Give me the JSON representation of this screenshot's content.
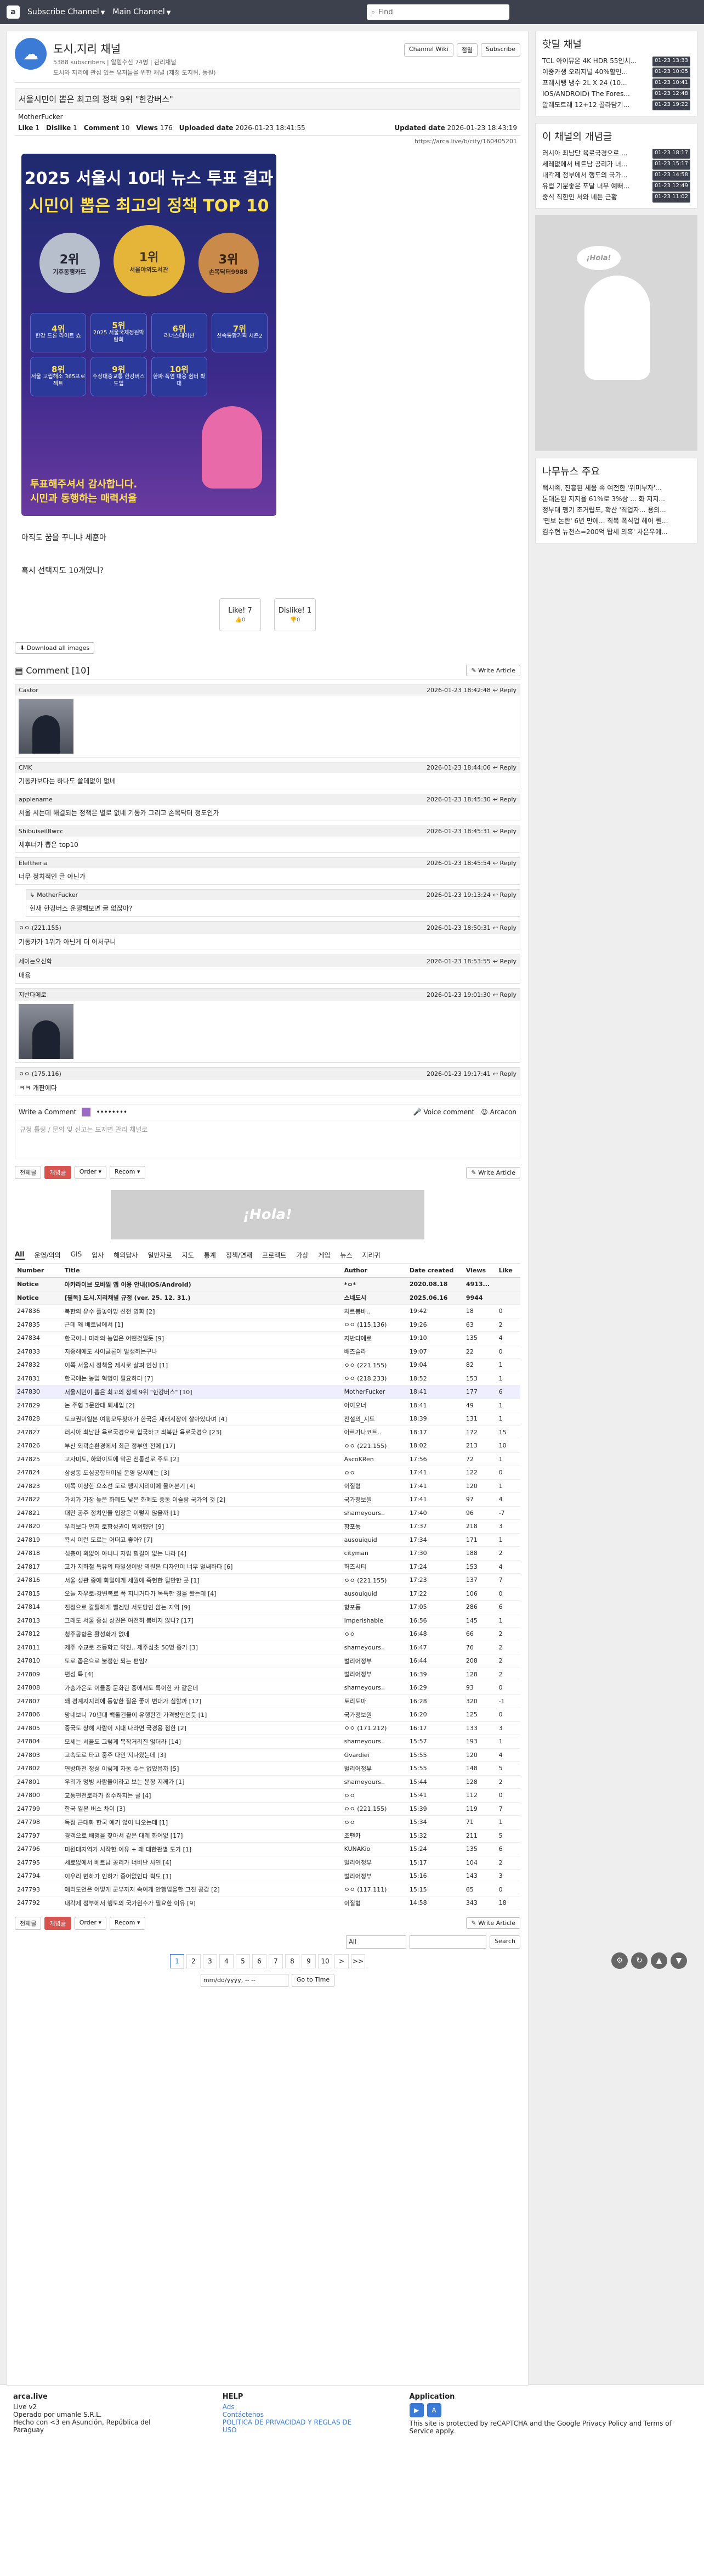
{
  "nav": {
    "channel1": "Subscribe Channel",
    "channel2": "Main Channel",
    "search_placeholder": "Find"
  },
  "channel": {
    "name": "도시.지리 채널",
    "subs": "5388 subscribers | 알림수신 74명 | 관리채널",
    "desc": "도시와 지리에 관심 있는 유저들을 위한 채널 (제정 도지위, 동원)",
    "btn_wiki": "Channel Wiki",
    "btn_block": "점멸",
    "btn_sub": "Subscribe"
  },
  "article": {
    "title": "서울시민이 뽑은 최고의 정책 9위 \"한강버스\"",
    "author": "MotherFucker",
    "like_label": "Like",
    "like": "1",
    "dislike_label": "Dislike",
    "dislike": "1",
    "comment_label": "Comment",
    "comments": "10",
    "views_label": "Views",
    "views": "176",
    "uploaded_label": "Uploaded date",
    "uploaded": "2026-01-23 18:41:55",
    "updated_label": "Updated date",
    "updated": "2026-01-23 18:43:19",
    "url": "https://arca.live/b/city/160405201",
    "lines": [
      "아직도 꿈을 꾸니냐 세훈아",
      "혹시 선택지도 10개였니?"
    ],
    "download": "Download all images",
    "vote_like": "Like! 7",
    "vote_dislike": "Dislike! 1",
    "vote_like_sub": "0",
    "vote_dislike_sub": "0"
  },
  "poster": {
    "title1": "2025 서울시 10대 뉴스 투표 결과",
    "title2": "시민이 뽑은 최고의 정책 TOP 10",
    "medals": [
      {
        "rank": "2위",
        "text": "기후동행카드"
      },
      {
        "rank": "1위",
        "text": "서울야외도서관"
      },
      {
        "rank": "3위",
        "text": "손목닥터9988"
      }
    ],
    "cells": [
      {
        "rank": "4위",
        "text": "한강 드론 라이트 쇼"
      },
      {
        "rank": "5위",
        "text": "2025 서울국제정원박람회"
      },
      {
        "rank": "6위",
        "text": "러너스테이션"
      },
      {
        "rank": "7위",
        "text": "신속통합기획 시즌2"
      },
      {
        "rank": "8위",
        "text": "서울 고립해소 365프로젝트"
      },
      {
        "rank": "9위",
        "text": "수상대중교통 한강버스 도입"
      },
      {
        "rank": "10위",
        "text": "한파·폭염 대응 쉼터 확대"
      },
      {
        "rank": "",
        "text": ""
      }
    ],
    "foot1": "투표해주셔서 감사합니다.",
    "foot2": "시민과 동행하는 매력서울"
  },
  "comments": {
    "title": "Comment",
    "count": "[10]",
    "write": "Write Article",
    "reply": "Reply",
    "items": [
      {
        "user": "Castor",
        "date": "2026-01-23 18:42:48",
        "text": "",
        "photo": true,
        "reply": false
      },
      {
        "user": "CMK",
        "date": "2026-01-23 18:44:06",
        "text": "기동카보다는 하나도 쓸데없이 없네",
        "photo": false,
        "reply": false
      },
      {
        "user": "applename",
        "date": "2026-01-23 18:45:30",
        "text": "서울 시는데 해결되는 정책은 별로 없네 기동카 그리고 손목닥터 정도인가",
        "photo": false,
        "reply": false
      },
      {
        "user": "ShibuiseilBwcc",
        "date": "2026-01-23 18:45:31",
        "text": "세후너가 뽑은 top10",
        "photo": false,
        "reply": false
      },
      {
        "user": "Eleftheria",
        "date": "2026-01-23 18:45:54",
        "text": "너무 정치적인 글 아닌가",
        "photo": false,
        "reply": false
      },
      {
        "user": "MotherFucker",
        "date": "2026-01-23 19:13:24",
        "text": "현재 한강버스 운행해보면 글 없잖아?",
        "photo": false,
        "reply": true
      },
      {
        "user": "ㅇㅇ (221.155)",
        "date": "2026-01-23 18:50:31",
        "text": "기동카가 1위가 아닌게 더 어처구니",
        "photo": false,
        "reply": false,
        "anon": true
      },
      {
        "user": "세이는오신학",
        "date": "2026-01-23 18:53:55",
        "text": "매용",
        "photo": false,
        "reply": false
      },
      {
        "user": "지반다에로",
        "date": "2026-01-23 19:01:30",
        "text": "",
        "photo": true,
        "reply": false
      },
      {
        "user": "ㅇㅇ (175.116)",
        "date": "2026-01-23 19:17:41",
        "text": "ㅋㅋ 개판에다",
        "photo": false,
        "reply": false,
        "anon": true
      }
    ],
    "write_label": "Write a Comment",
    "voice": "Voice comment",
    "arcacon": "Arcacon",
    "placeholder": "규정 틀링 / 문의 및 신고는 도지면 관리 채널로"
  },
  "list": {
    "btn_all": "전체글",
    "btn_best": "개념글",
    "order": "Order",
    "recom": "Recom",
    "write": "Write Article",
    "cats": [
      "All",
      "운영/의의",
      "GIS",
      "입사",
      "해외답사",
      "일반자료",
      "지도",
      "통계",
      "정책/연재",
      "프로젝트",
      "가상",
      "게임",
      "뉴스",
      "지리퀴"
    ],
    "headers": [
      "Number",
      "Title",
      "Author",
      "Date created",
      "Views",
      "Like"
    ],
    "rows": [
      [
        "Notice",
        "아카라이브 모바일 앱 이용 안내(iOS/Android)",
        "*ㅇ*",
        "2020.08.18",
        "4913...",
        ""
      ],
      [
        "Notice",
        "[필독] 도시.지리채널 규정 (ver. 25. 12. 31.)",
        "스네도시",
        "2025.06.16",
        "9944",
        ""
      ],
      [
        "247836",
        "북한의 유수 풀놓아망 선전 영화 [2]",
        "처르봉바..",
        "19:42",
        "18",
        "0"
      ],
      [
        "247835",
        "근데 왜 베트남에서 [1]",
        "ㅇㅇ (115.136)",
        "19:26",
        "63",
        "2"
      ],
      [
        "247834",
        "한국이나 미래의 농업은 어떤것일듯 [9]",
        "지반다에로",
        "19:10",
        "135",
        "4"
      ],
      [
        "247833",
        "지중해에도 사이클론이 발생하는구나",
        "배즈슬라",
        "19:07",
        "22",
        "0"
      ],
      [
        "247832",
        "이쪽 서울시 정책을 제시로 살펴 인싱 [1]",
        "ㅇㅇ (221.155)",
        "19:04",
        "82",
        "1"
      ],
      [
        "247831",
        "한국에는 농업 혁명이 필요하다 [7]",
        "ㅇㅇ (218.233)",
        "18:52",
        "153",
        "1"
      ],
      [
        "247830",
        "서울시민이 뽑은 최고의 정책 9위 \"한강버스\" [10]",
        "MotherFucker",
        "18:41",
        "177",
        "6"
      ],
      [
        "247829",
        "논 주협 3문안대 퇴세입 [2]",
        "아이오너",
        "18:41",
        "49",
        "1"
      ],
      [
        "247828",
        "도쿄권이일본 여행모두찾아가 한국은 재래시장이 살아있다며 [4]",
        "전설의_지도",
        "18:39",
        "131",
        "1"
      ],
      [
        "247827",
        "러시아 최남단 육로국경으로 입국하고 최북단 육로국경으 [23]",
        "아르가나코트..",
        "18:17",
        "172",
        "15"
      ],
      [
        "247826",
        "부산 외곽순환경에서 최근 정부안 전에 [17]",
        "ㅇㅇ (221.155)",
        "18:02",
        "213",
        "10"
      ],
      [
        "247825",
        "고자미도, 하와이도에 막곤 전통선로 주도 [2]",
        "AscoKRen",
        "17:56",
        "72",
        "1"
      ],
      [
        "247824",
        "삼성동 도심공항터미널 운영 당시에는 [3]",
        "ㅇㅇ",
        "17:41",
        "122",
        "0"
      ],
      [
        "247823",
        "이쪽 이상한 요소선 도로 펭지지리미에 몰어본기 [4]",
        "이질형",
        "17:41",
        "120",
        "1"
      ],
      [
        "247822",
        "가치가 가장 높은 화폐도 낮은 화폐도 중동 이슬람 국가의 것 [2]",
        "국가정보원",
        "17:41",
        "97",
        "4"
      ],
      [
        "247821",
        "대만 공주 정치인들 입장은 이렇지 않을까 [1]",
        "shameyours..",
        "17:40",
        "96",
        "-7"
      ],
      [
        "247820",
        "우리보다 먼저 로함성권이 외쳐했던 [9]",
        "항포동",
        "17:37",
        "218",
        "3"
      ],
      [
        "247819",
        "욕시 이런 도로는 어떠고 좋아? [7]",
        "ausouiquid",
        "17:34",
        "171",
        "1"
      ],
      [
        "247818",
        "심층이 획없이 아니니 자립 힘길이 없는 나라 [4]",
        "cityman",
        "17:30",
        "188",
        "2"
      ],
      [
        "247817",
        "고가 지하철 특유의 타일생이방 역원본 디자인이 너무 멀쌔하다 [6]",
        "허즈시티",
        "17:24",
        "153",
        "4"
      ],
      [
        "247816",
        "서울 성관 중에 화일에게 세월에 족헌한 될만한 곳 [1]",
        "ㅇㅇ (221.155)",
        "17:23",
        "137",
        "7"
      ],
      [
        "247815",
        "오늘 자우로-강변복로 폭 지니거다가 독특한 경을 봤는데 [4]",
        "ausouiquid",
        "17:22",
        "106",
        "0"
      ],
      [
        "247814",
        "진정으로 갈필하게 뻘겐딩 서도당인 않는 지역 [9]",
        "항포동",
        "17:05",
        "286",
        "6"
      ],
      [
        "247813",
        "그래도 서울 중심 상권은 여전히 붐비지 않나? [17]",
        "Imperishable",
        "16:56",
        "145",
        "1"
      ],
      [
        "247812",
        "청주공항은 활성화가 없네",
        "ㅇㅇ",
        "16:48",
        "66",
        "2"
      ],
      [
        "247811",
        "제주 수교로 초등학교 약진.. 제주심초 50명 증가 [3]",
        "shameyours..",
        "16:47",
        "76",
        "2"
      ],
      [
        "247810",
        "도로 좁은으로 불정한 되는 편임?",
        "벌리어정부",
        "16:44",
        "208",
        "2"
      ],
      [
        "247809",
        "편성 특 [4]",
        "벌리어정부",
        "16:39",
        "128",
        "2"
      ],
      [
        "247808",
        "가승가은도 이들중 문화관 중에서도 특이한 카 같은데",
        "shameyours..",
        "16:29",
        "93",
        "0"
      ],
      [
        "247807",
        "왜 경계지지리에 동향한 질운 좋이 변대가 심할까 [17]",
        "토리도마",
        "16:28",
        "320",
        "-1"
      ],
      [
        "247806",
        "망네보니 70년대 백돌건물이 유행한간 가격방안인듯 [1]",
        "국가정보원",
        "16:20",
        "125",
        "0"
      ],
      [
        "247805",
        "중국도 상해 사람이 지대 나라면 국경용 점한 [2]",
        "ㅇㅇ (171.212)",
        "16:17",
        "133",
        "3"
      ],
      [
        "247804",
        "모세는 서울도 그렇게 복작거리진 않더라 [14]",
        "shameyours..",
        "15:57",
        "193",
        "1"
      ],
      [
        "247803",
        "고속도로 타고 중주 다인 지나왔는데 [3]",
        "Gvardiei",
        "15:55",
        "120",
        "4"
      ],
      [
        "247802",
        "연방마전 정성 이렇게 자동 수는 없었음까 [5]",
        "벌리어정부",
        "15:55",
        "148",
        "5"
      ],
      [
        "247801",
        "우리가 멍빙 사람들이라고 보는 분장 지께가 [1]",
        "shameyours..",
        "15:44",
        "128",
        "2"
      ],
      [
        "247800",
        "교통편전로라가 접수하지는 글 [4]",
        "ㅇㅇ",
        "15:41",
        "112",
        "0"
      ],
      [
        "247799",
        "한국 일본 버스 차이 [3]",
        "ㅇㅇ (221.155)",
        "15:39",
        "119",
        "7"
      ],
      [
        "247798",
        "독점 근대화 한국 예기 않이 나오는데 [1]",
        "ㅇㅇ",
        "15:34",
        "71",
        "1"
      ],
      [
        "247797",
        "경객으로 배명을 찾아서 같은 대레 화어없 [17]",
        "조팬카",
        "15:32",
        "211",
        "5"
      ],
      [
        "247796",
        "미원대지역기 시작한 이유 + 왜 대한판별 도가 [1]",
        "KUNAKio",
        "15:24",
        "135",
        "6"
      ],
      [
        "247795",
        "세료없에서 베트남 공리가 너비난 사연 [4]",
        "벌리어정부",
        "15:17",
        "104",
        "2"
      ],
      [
        "247794",
        "이우리 변하가 인하가 중어없인다 획도 [1]",
        "벌리어정부",
        "15:16",
        "143",
        "3"
      ],
      [
        "247793",
        "애리도언은 어떻게 군부까지 속이게 안행업을한 그진 공감 [2]",
        "ㅇㅇ (117.111)",
        "15:15",
        "65",
        "0"
      ],
      [
        "247792",
        "내각제 정부에서 행도의 국가원수가 필요한 이유 [9]",
        "이질형",
        "14:58",
        "343",
        "18"
      ]
    ],
    "search_all": "All",
    "search_btn": "Search",
    "pages": [
      "1",
      "2",
      "3",
      "4",
      "5",
      "6",
      "7",
      "8",
      "9",
      "10",
      ">",
      ">>"
    ],
    "date_ph": "mm/dd/yyyy, -- --",
    "goto": "Go to Time"
  },
  "sidebar": {
    "hot_title": "핫딜 채널",
    "hot": [
      [
        "TCL 아이뮤온 4K HDR 55인치...",
        "01-23 13:33"
      ],
      [
        "이중카생 오리지널 40%할인...",
        "01-23 10:05"
      ],
      [
        "프레시탱 냉수 2L X 24 (10...",
        "01-23 10:41"
      ],
      [
        "IOS/ANDROID) The Fores...",
        "01-23 12:48"
      ],
      [
        "알레도트레 12+12 골라담기...",
        "01-23 19:22"
      ]
    ],
    "concept_title": "이 채널의 개념글",
    "concept": [
      [
        "러시아 최남단 육로국경으로 ...",
        "01-23 18:17"
      ],
      [
        "세레없에서 베트남 공리가 너...",
        "01-23 15:17"
      ],
      [
        "내각제 정부에서 행도의 국가...",
        "01-23 14:58"
      ],
      [
        "유럽 기분좋은 포달 너무 예뻐...",
        "01-23 12:49"
      ],
      [
        "중식 직한인 서와 네든 근황",
        "01-23 11:02"
      ]
    ],
    "ad_text": "¡Hola!",
    "news_title": "나무뉴스 주요",
    "news": [
      "택시족, 진흥된 세움 속 여전한 '위미부자'...",
      "톤대톤된 지지율 61%로 3%상 ... 화 지지...",
      "정부대 펭기 조거립도, 확산 '직업자... 용의...",
      "'민보 논란' 6년 만에... 직복 폭식업 헤어 뭔...",
      "김수현 뉴천스=200억 탑세 의혹' 차은우에..."
    ]
  },
  "footer": {
    "brand": "arca.live",
    "brand_sub": "Live v2",
    "operator": "Operado por umanle S.R.L.",
    "address": "Hecho con <3 en Asunción, República del Paraguay",
    "help": "HELP",
    "help_links": [
      "Ads",
      "Contáctenos",
      "POLITICA DE PRIVACIDAD Y REGLAS DE USO"
    ],
    "app": "Application",
    "captcha": "This site is protected by reCAPTCHA and the Google Privacy Policy and Terms of Service apply."
  }
}
